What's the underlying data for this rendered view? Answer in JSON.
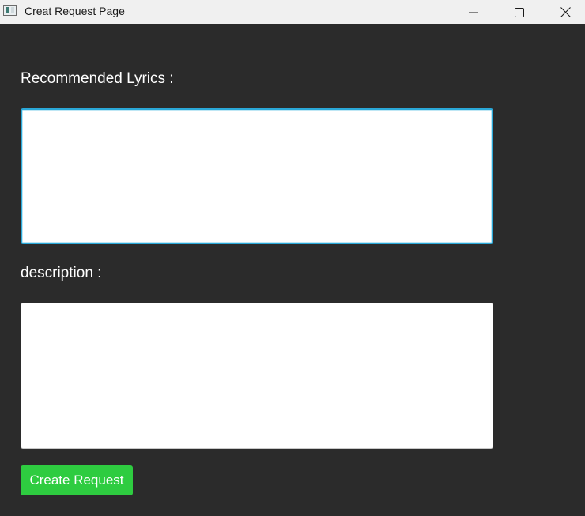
{
  "window": {
    "title": "Creat Request Page",
    "controls": [
      "minimize-icon",
      "maximize-icon",
      "close-icon"
    ]
  },
  "form": {
    "lyrics_label": "Recommended Lyrics :",
    "lyrics_value": "",
    "description_label": "description :",
    "description_value": "",
    "submit_label": "Create Request"
  },
  "colors": {
    "background": "#2b2b2b",
    "titlebar": "#f0f0f0",
    "focus_border": "#2aa8d8",
    "button": "#2ecc40",
    "text": "#ffffff"
  }
}
